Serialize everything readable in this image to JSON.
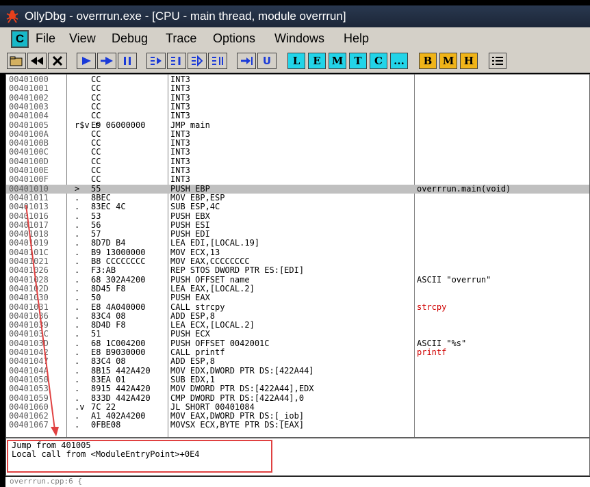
{
  "window": {
    "title": "OllyDbg - overrrun.exe - [CPU - main thread, module overrrun]"
  },
  "menu": {
    "sys_label": "C",
    "items": [
      "File",
      "View",
      "Debug",
      "Trace",
      "Options",
      "Windows",
      "Help"
    ]
  },
  "toolbar": {
    "cyan_buttons": [
      "L",
      "E",
      "M",
      "T",
      "C",
      "..."
    ],
    "gold_buttons": [
      "B",
      "M",
      "H"
    ]
  },
  "disasm": {
    "rows": [
      {
        "addr": "00401000",
        "hex": "CC",
        "asm": "INT3",
        "cmt": ""
      },
      {
        "addr": "00401001",
        "hex": "CC",
        "asm": "INT3",
        "cmt": ""
      },
      {
        "addr": "00401002",
        "hex": "CC",
        "asm": "INT3",
        "cmt": ""
      },
      {
        "addr": "00401003",
        "hex": "CC",
        "asm": "INT3",
        "cmt": ""
      },
      {
        "addr": "00401004",
        "hex": "CC",
        "asm": "INT3",
        "cmt": ""
      },
      {
        "addr": "00401005",
        "hex": "E9 06000000",
        "asm": "JMP main",
        "cmt": "",
        "jmp": "r$v r"
      },
      {
        "addr": "0040100A",
        "hex": "CC",
        "asm": "INT3",
        "cmt": ""
      },
      {
        "addr": "0040100B",
        "hex": "CC",
        "asm": "INT3",
        "cmt": ""
      },
      {
        "addr": "0040100C",
        "hex": "CC",
        "asm": "INT3",
        "cmt": ""
      },
      {
        "addr": "0040100D",
        "hex": "CC",
        "asm": "INT3",
        "cmt": ""
      },
      {
        "addr": "0040100E",
        "hex": "CC",
        "asm": "INT3",
        "cmt": ""
      },
      {
        "addr": "0040100F",
        "hex": "CC",
        "asm": "INT3",
        "cmt": ""
      },
      {
        "addr": "00401010",
        "hex": "55",
        "asm": "PUSH EBP",
        "cmt": "overrrun.main(void)",
        "sel": true,
        "jmp": ">"
      },
      {
        "addr": "00401011",
        "hex": "8BEC",
        "asm": "MOV EBP,ESP",
        "cmt": "",
        "jmp": "."
      },
      {
        "addr": "00401013",
        "hex": "83EC 4C",
        "asm": "SUB ESP,4C",
        "cmt": "",
        "jmp": "."
      },
      {
        "addr": "00401016",
        "hex": "53",
        "asm": "PUSH EBX",
        "cmt": "",
        "jmp": "."
      },
      {
        "addr": "00401017",
        "hex": "56",
        "asm": "PUSH ESI",
        "cmt": "",
        "jmp": "."
      },
      {
        "addr": "00401018",
        "hex": "57",
        "asm": "PUSH EDI",
        "cmt": "",
        "jmp": "."
      },
      {
        "addr": "00401019",
        "hex": "8D7D B4",
        "asm": "LEA EDI,[LOCAL.19]",
        "cmt": "",
        "jmp": "."
      },
      {
        "addr": "0040101C",
        "hex": "B9 13000000",
        "asm": "MOV ECX,13",
        "cmt": "",
        "jmp": "."
      },
      {
        "addr": "00401021",
        "hex": "B8 CCCCCCCC",
        "asm": "MOV EAX,CCCCCCCC",
        "cmt": "",
        "jmp": "."
      },
      {
        "addr": "00401026",
        "hex": "F3:AB",
        "asm": "REP STOS DWORD PTR ES:[EDI]",
        "cmt": "",
        "jmp": "."
      },
      {
        "addr": "00401028",
        "hex": "68 302A4200",
        "asm": "PUSH OFFSET name",
        "cmt": "ASCII \"overrun\"",
        "jmp": "."
      },
      {
        "addr": "0040102D",
        "hex": "8D45 F8",
        "asm": "LEA EAX,[LOCAL.2]",
        "cmt": "",
        "jmp": "."
      },
      {
        "addr": "00401030",
        "hex": "50",
        "asm": "PUSH EAX",
        "cmt": "",
        "jmp": "."
      },
      {
        "addr": "00401031",
        "hex": "E8 4A040000",
        "asm": "CALL strcpy",
        "cmt": "strcpy",
        "red": true,
        "jmp": "."
      },
      {
        "addr": "00401036",
        "hex": "83C4 08",
        "asm": "ADD ESP,8",
        "cmt": "",
        "jmp": "."
      },
      {
        "addr": "00401039",
        "hex": "8D4D F8",
        "asm": "LEA ECX,[LOCAL.2]",
        "cmt": "",
        "jmp": "."
      },
      {
        "addr": "0040103C",
        "hex": "51",
        "asm": "PUSH ECX",
        "cmt": "",
        "jmp": "."
      },
      {
        "addr": "0040103D",
        "hex": "68 1C004200",
        "asm": "PUSH OFFSET 0042001C",
        "cmt": "ASCII \"%s\"",
        "jmp": "."
      },
      {
        "addr": "00401042",
        "hex": "E8 B9030000",
        "asm": "CALL printf",
        "cmt": "printf",
        "red": true,
        "jmp": "."
      },
      {
        "addr": "00401047",
        "hex": "83C4 08",
        "asm": "ADD ESP,8",
        "cmt": "",
        "jmp": "."
      },
      {
        "addr": "0040104A",
        "hex": "8B15 442A420",
        "asm": "MOV EDX,DWORD PTR DS:[422A44]",
        "cmt": "",
        "jmp": "."
      },
      {
        "addr": "00401050",
        "hex": "83EA 01",
        "asm": "SUB EDX,1",
        "cmt": "",
        "jmp": "."
      },
      {
        "addr": "00401053",
        "hex": "8915 442A420",
        "asm": "MOV DWORD PTR DS:[422A44],EDX",
        "cmt": "",
        "jmp": "."
      },
      {
        "addr": "00401059",
        "hex": "833D 442A420",
        "asm": "CMP DWORD PTR DS:[422A44],0",
        "cmt": "",
        "jmp": "."
      },
      {
        "addr": "00401060",
        "hex": "7C 22",
        "asm": "JL SHORT 00401084",
        "cmt": "",
        "jmp": ".v"
      },
      {
        "addr": "00401062",
        "hex": "A1 402A4200",
        "asm": "MOV EAX,DWORD PTR DS:[_iob]",
        "cmt": "",
        "jmp": "."
      },
      {
        "addr": "00401067",
        "hex": "0FBE08",
        "asm": "MOVSX ECX,BYTE PTR DS:[EAX]",
        "cmt": "",
        "jmp": "."
      }
    ]
  },
  "info": {
    "line1": "Jump from 401005",
    "line2": "Local call from <ModuleEntryPoint>+0E4"
  },
  "status": {
    "source": "overrrun.cpp:6 {"
  },
  "colors": {
    "accent_red": "#e04040",
    "cyan": "#22d4e8",
    "gold": "#f0b418"
  }
}
